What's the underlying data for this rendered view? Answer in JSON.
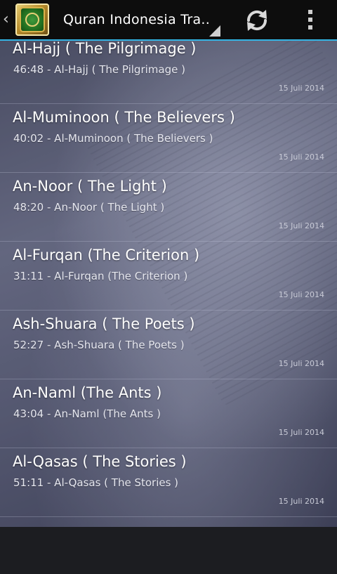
{
  "actionbar": {
    "title": "Quran Indonesia Tra..",
    "up_glyph": "‹",
    "icons": {
      "up": "up-caret-icon",
      "app": "quran-app-icon",
      "refresh": "refresh-icon",
      "overflow": "overflow-menu-icon"
    },
    "accent_color": "#33b5e5"
  },
  "surahs": [
    {
      "title": "Al-Hajj ( The Pilgrimage )",
      "subtitle": "46:48 - Al-Hajj ( The Pilgrimage )",
      "date": "15 Juli 2014"
    },
    {
      "title": "Al-Muminoon ( The Believers )",
      "subtitle": "40:02 - Al-Muminoon ( The Believers )",
      "date": "15 Juli 2014"
    },
    {
      "title": "An-Noor ( The Light )",
      "subtitle": "48:20 - An-Noor ( The Light )",
      "date": "15 Juli 2014"
    },
    {
      "title": "Al-Furqan (The Criterion )",
      "subtitle": "31:11 - Al-Furqan (The Criterion )",
      "date": "15 Juli 2014"
    },
    {
      "title": "Ash-Shuara ( The Poets )",
      "subtitle": "52:27 - Ash-Shuara ( The Poets )",
      "date": "15 Juli 2014"
    },
    {
      "title": "An-Naml (The Ants )",
      "subtitle": "43:04 - An-Naml (The Ants )",
      "date": "15 Juli 2014"
    },
    {
      "title": "Al-Qasas ( The Stories )",
      "subtitle": "51:11 - Al-Qasas ( The Stories )",
      "date": "15 Juli 2014"
    }
  ]
}
